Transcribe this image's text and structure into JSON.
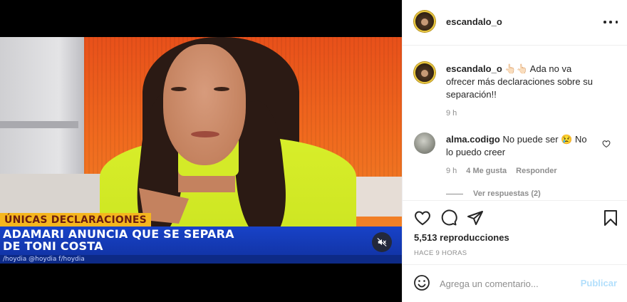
{
  "media": {
    "lower_third_tag": "ÚNICAS DECLARACIONES",
    "headline_line1": "ADAMARI ANUNCIA QUE SE SEPARA",
    "headline_line2": "DE TONI COSTA",
    "ticker": "/hoydia    @hoydia    f/hoydia",
    "mute_icon": "muted-speaker-icon"
  },
  "header": {
    "username": "escandalo_o",
    "more_icon": "more-options-icon"
  },
  "caption": {
    "username": "escandalo_o",
    "emoji": "👆🏻👆🏻",
    "text": "Ada no va ofrecer más declaraciones sobre su separación!!",
    "time": "9 h"
  },
  "comment": {
    "username": "alma.codigo",
    "text": "No puede ser 😢 No lo puedo creer",
    "time": "9 h",
    "likes": "4 Me gusta",
    "reply_label": "Responder",
    "view_replies": "Ver respuestas (2)"
  },
  "actions": {
    "icons": [
      "heart-icon",
      "comment-icon",
      "share-icon",
      "bookmark-icon"
    ],
    "views_count": "5,513",
    "views_label": "reproducciones",
    "posted": "HACE 9 HORAS"
  },
  "add_comment": {
    "placeholder": "Agrega un comentario...",
    "post_label": "Publicar",
    "post_color": "#b2dffc"
  }
}
